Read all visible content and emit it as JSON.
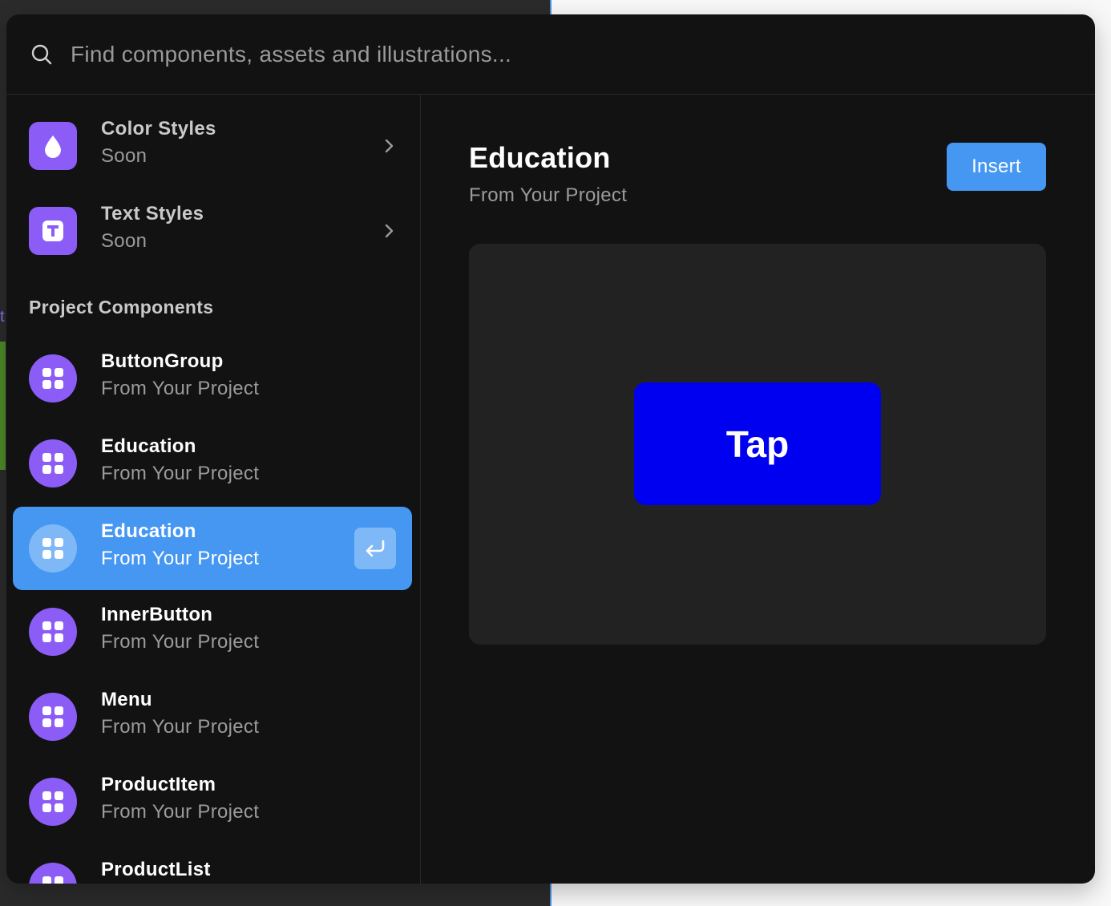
{
  "search": {
    "placeholder": "Find components, assets and illustrations...",
    "icon": "search-icon"
  },
  "sidebar": {
    "styles": [
      {
        "title": "Color Styles",
        "subtitle": "Soon",
        "icon": "droplet-icon"
      },
      {
        "title": "Text Styles",
        "subtitle": "Soon",
        "icon": "text-t-icon"
      }
    ],
    "section_heading": "Project Components",
    "components": [
      {
        "title": "ButtonGroup",
        "subtitle": "From Your Project"
      },
      {
        "title": "Education",
        "subtitle": "From Your Project"
      },
      {
        "title": "Education",
        "subtitle": "From Your Project",
        "selected": true
      },
      {
        "title": "InnerButton",
        "subtitle": "From Your Project"
      },
      {
        "title": "Menu",
        "subtitle": "From Your Project"
      },
      {
        "title": "ProductItem",
        "subtitle": "From Your Project"
      },
      {
        "title": "ProductList",
        "subtitle": ""
      }
    ]
  },
  "detail": {
    "title": "Education",
    "subtitle": "From Your Project",
    "insert_label": "Insert",
    "preview_button_label": "Tap"
  },
  "colors": {
    "accent": "#4597f2",
    "icon_purple": "#8c5cf6",
    "preview_blue": "#0000f0",
    "modal_bg": "#121212"
  }
}
